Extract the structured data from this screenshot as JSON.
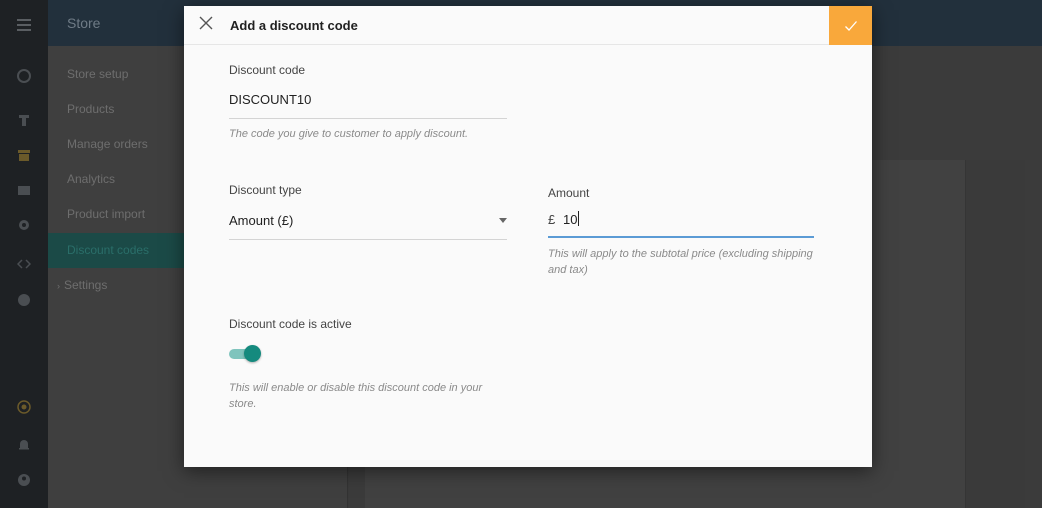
{
  "app": {
    "title": "Store",
    "rail_icons": [
      "menu-icon",
      "dashboard-icon",
      "tshirt-icon",
      "store-icon",
      "mail-icon",
      "gear-icon",
      "code-icon",
      "help-icon",
      "star-icon",
      "bell-icon",
      "account-icon"
    ],
    "nav_items": [
      {
        "label": "Store setup",
        "active": false
      },
      {
        "label": "Products",
        "active": false
      },
      {
        "label": "Manage orders",
        "active": false
      },
      {
        "label": "Analytics",
        "active": false
      },
      {
        "label": "Product import",
        "active": false
      },
      {
        "label": "Discount codes",
        "active": true
      },
      {
        "label": "Settings",
        "active": false,
        "expandable": true
      }
    ]
  },
  "modal": {
    "title": "Add a discount code",
    "discount_code": {
      "label": "Discount code",
      "value": "DISCOUNT10",
      "hint": "The code you give to customer to apply discount."
    },
    "discount_type": {
      "label": "Discount type",
      "value": "Amount (£)"
    },
    "amount": {
      "label": "Amount",
      "currency": "£",
      "value": "10",
      "hint": "This will apply to the subtotal price (excluding shipping and tax)"
    },
    "active": {
      "label": "Discount code is active",
      "on": true,
      "hint": "This will enable or disable this discount code in your store."
    }
  },
  "colors": {
    "accent": "#f9a83b",
    "toggle": "#158a7e",
    "focus_underline": "#5b9bd5"
  }
}
